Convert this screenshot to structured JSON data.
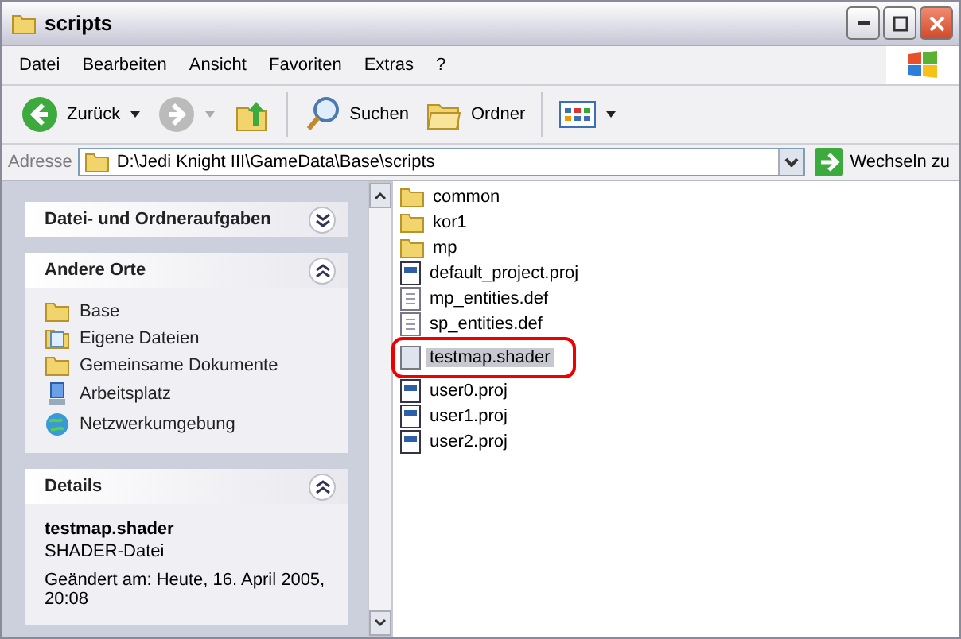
{
  "window": {
    "title": "scripts"
  },
  "menu": [
    "Datei",
    "Bearbeiten",
    "Ansicht",
    "Favoriten",
    "Extras",
    "?"
  ],
  "toolbar": {
    "back": "Zurück",
    "search": "Suchen",
    "folders": "Ordner"
  },
  "address": {
    "label": "Adresse",
    "value": "D:\\Jedi Knight III\\GameData\\Base\\scripts",
    "go": "Wechseln zu"
  },
  "panels": [
    {
      "title": "Datei- und Ordneraufgaben",
      "expanded": false
    },
    {
      "title": "Andere Orte",
      "expanded": true,
      "items": [
        {
          "label": "Base",
          "kind": "folder"
        },
        {
          "label": "Eigene Dateien",
          "kind": "documents"
        },
        {
          "label": "Gemeinsame Dokumente",
          "kind": "folder"
        },
        {
          "label": "Arbeitsplatz",
          "kind": "computer"
        },
        {
          "label": "Netzwerkumgebung",
          "kind": "network"
        }
      ]
    },
    {
      "title": "Details",
      "expanded": true,
      "name": "testmap.shader",
      "type": "SHADER-Datei",
      "modified": "Geändert am: Heute, 16. April 2005, 20:08"
    }
  ],
  "files": [
    {
      "name": "common",
      "kind": "folder",
      "selected": false
    },
    {
      "name": "kor1",
      "kind": "folder",
      "selected": false
    },
    {
      "name": "mp",
      "kind": "folder",
      "selected": false
    },
    {
      "name": "default_project.proj",
      "kind": "proj",
      "selected": false
    },
    {
      "name": "mp_entities.def",
      "kind": "def",
      "selected": false
    },
    {
      "name": "sp_entities.def",
      "kind": "def",
      "selected": false
    },
    {
      "name": "testmap.shader",
      "kind": "shader",
      "selected": true
    },
    {
      "name": "user0.proj",
      "kind": "proj",
      "selected": false
    },
    {
      "name": "user1.proj",
      "kind": "proj",
      "selected": false
    },
    {
      "name": "user2.proj",
      "kind": "proj",
      "selected": false
    }
  ]
}
